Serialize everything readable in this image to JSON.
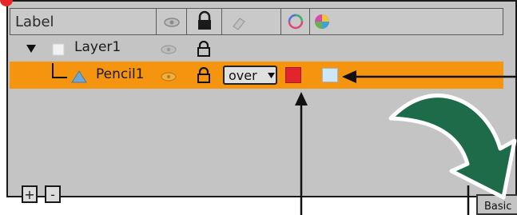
{
  "header": {
    "label_column": "Label",
    "icons": [
      "eye-icon",
      "lock-icon",
      "eraser-icon",
      "color-ring-icon",
      "color-wheel-icon"
    ]
  },
  "layers": [
    {
      "name": "Layer1",
      "expanded_icon": "triangle-down-icon",
      "visible_icon": "eye-icon",
      "lock_icon": "lock-icon"
    },
    {
      "name": "Pencil1",
      "blend_mode": "over",
      "color_swatch": "#e2252d",
      "fill_swatch": "#cfe6f7",
      "highlight": "#f5950f"
    }
  ],
  "footer": {
    "add_label": "+",
    "remove_label": "-",
    "basic_tab": "Basic"
  }
}
